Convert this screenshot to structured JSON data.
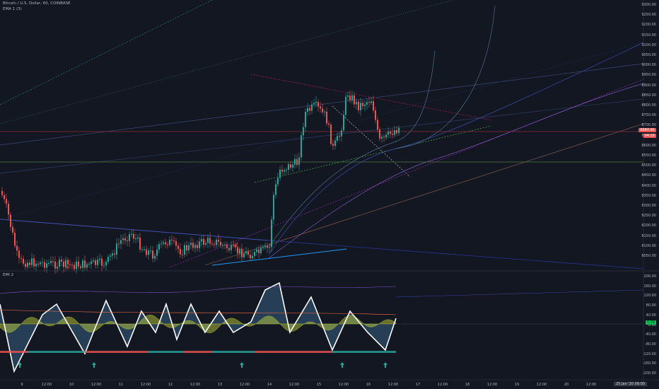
{
  "main_legend": {
    "symbol": "Bitcoin / U.S. Dollar, 60, COINBASE",
    "indicator": "EMA 1 (3)"
  },
  "sub_legend": {
    "title": "EMI 2"
  },
  "price_axis": {
    "labels": [
      "9300.00",
      "9250.00",
      "9200.00",
      "9150.00",
      "9100.00",
      "9050.00",
      "9000.00",
      "8950.00",
      "8900.00",
      "8850.00",
      "8800.00",
      "8750.00",
      "8700.00",
      "8650.00",
      "8600.00",
      "8550.00",
      "8500.00",
      "8450.00",
      "8400.00",
      "8350.00",
      "8300.00",
      "8250.00",
      "8200.00",
      "8150.00",
      "8100.00",
      "8050.00"
    ],
    "price_badge": "8684.95",
    "countdown_badge": "04:26"
  },
  "osc_axis": {
    "labels": [
      "200.00",
      "160.00",
      "120.00",
      "80.00",
      "40.00",
      "0.00",
      "-40.00",
      "-80.00",
      "-120.00",
      "-160.00",
      "-200.00"
    ],
    "value_badge": "0.39"
  },
  "time_axis": {
    "labels": [
      "9",
      "12:00",
      "10",
      "12:00",
      "11",
      "12:00",
      "12",
      "12:00",
      "13",
      "12:00",
      "14",
      "12:00",
      "15",
      "12:00",
      "16",
      "12:00",
      "17",
      "12:00",
      "18",
      "12:00",
      "19",
      "12:00",
      "20",
      "12:00",
      "21"
    ],
    "badge": "25 Jan '20  09:00"
  },
  "colors": {
    "background": "#131722",
    "up": "#26a69a",
    "down": "#ef5350",
    "hline_red": "#8b2e3b",
    "hline_green": "#2e6b3b"
  }
}
